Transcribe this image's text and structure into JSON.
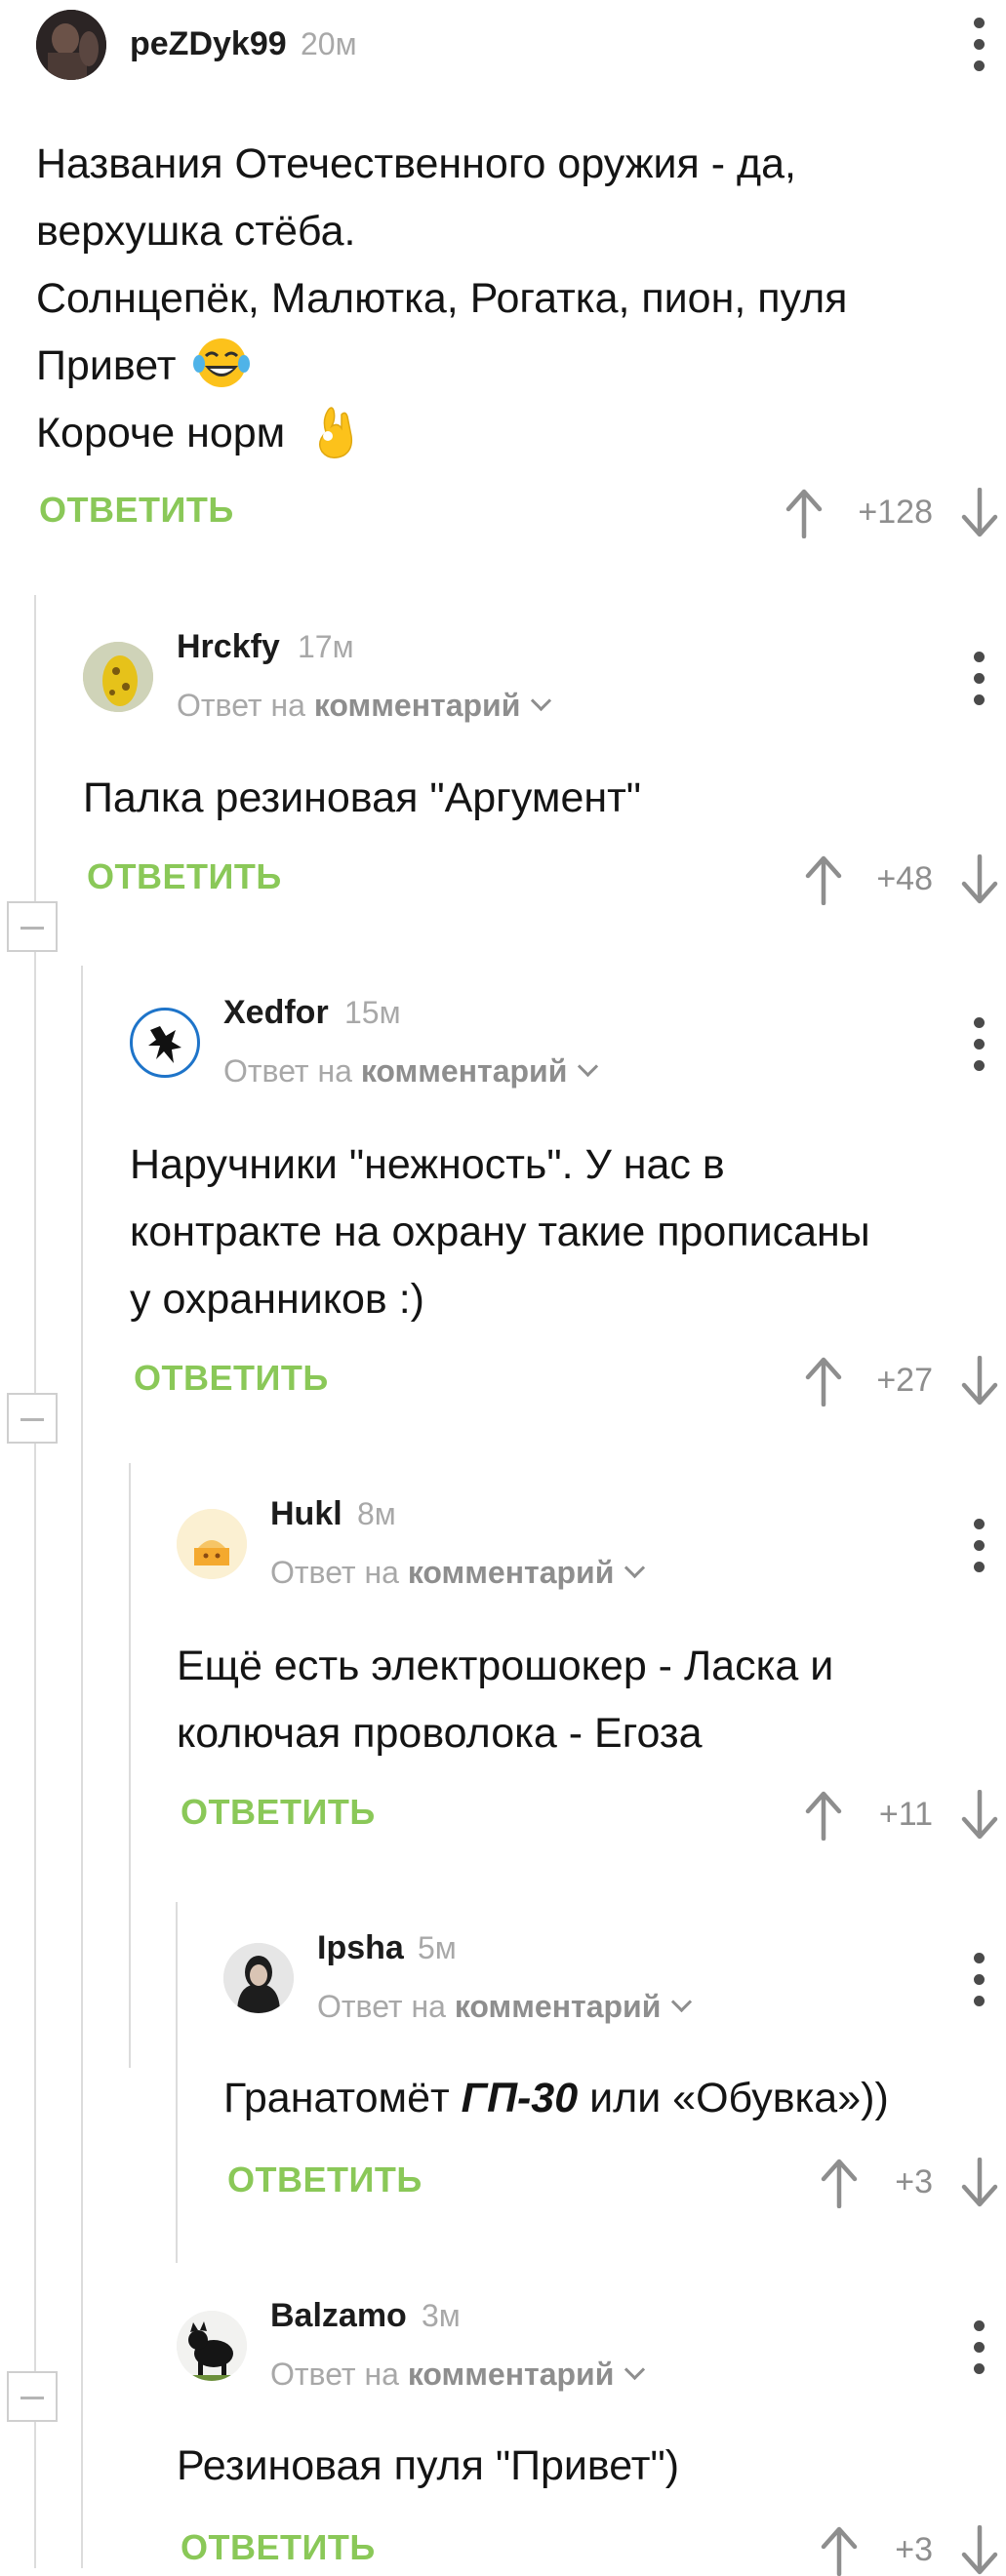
{
  "comments": [
    {
      "username": "peZDyk99",
      "time": "20м",
      "lines": [
        "Названия Отечественного оружия - да,",
        "верхушка стёба.",
        "Солнцепёк, Малютка, Рогатка, пион, пуля",
        "Привет",
        "Короче норм"
      ],
      "reply_label": "ОТВЕТИТЬ",
      "rating": "+128"
    },
    {
      "username": "Hrckfy",
      "time": "17м",
      "reply_prefix": "Ответ на",
      "reply_target": "комментарий",
      "lines": [
        "Палка резиновая \"Аргумент\""
      ],
      "reply_label": "ОТВЕТИТЬ",
      "rating": "+48"
    },
    {
      "username": "Xedfor",
      "time": "15м",
      "reply_prefix": "Ответ на",
      "reply_target": "комментарий",
      "lines": [
        "Наручники \"нежность\". У нас в",
        "контракте на охрану такие прописаны",
        "у охранников :)"
      ],
      "reply_label": "ОТВЕТИТЬ",
      "rating": "+27"
    },
    {
      "username": "Hukl",
      "time": "8м",
      "reply_prefix": "Ответ на",
      "reply_target": "комментарий",
      "lines": [
        "Ещё есть электрошокер - Ласка и",
        "колючая проволока - Егоза"
      ],
      "reply_label": "ОТВЕТИТЬ",
      "rating": "+11"
    },
    {
      "username": "Ipsha",
      "time": "5м",
      "reply_prefix": "Ответ на",
      "reply_target": "комментарий",
      "line_pre": "Гранатомёт ",
      "line_bold": "ГП-30",
      "line_post": " или «Обувка»))",
      "reply_label": "ОТВЕТИТЬ",
      "rating": "+3"
    },
    {
      "username": "Balzamo",
      "time": "3м",
      "reply_prefix": "Ответ на",
      "reply_target": "комментарий",
      "lines": [
        "Резиновая пуля \"Привет\")"
      ],
      "reply_label": "ОТВЕТИТЬ",
      "rating": "+3"
    }
  ],
  "icons": {
    "upvote": "arrow-up-icon",
    "downvote": "arrow-down-icon",
    "more": "kebab-menu-icon",
    "collapse": "collapse-thread-icon",
    "laugh_emoji": "laughing-tears-emoji",
    "ok_emoji": "ok-hand-emoji"
  },
  "colors": {
    "accent_green": "#8ac858",
    "meta_gray": "#a8a8a8",
    "text": "#141414",
    "thread_line": "#dcdcdc"
  }
}
